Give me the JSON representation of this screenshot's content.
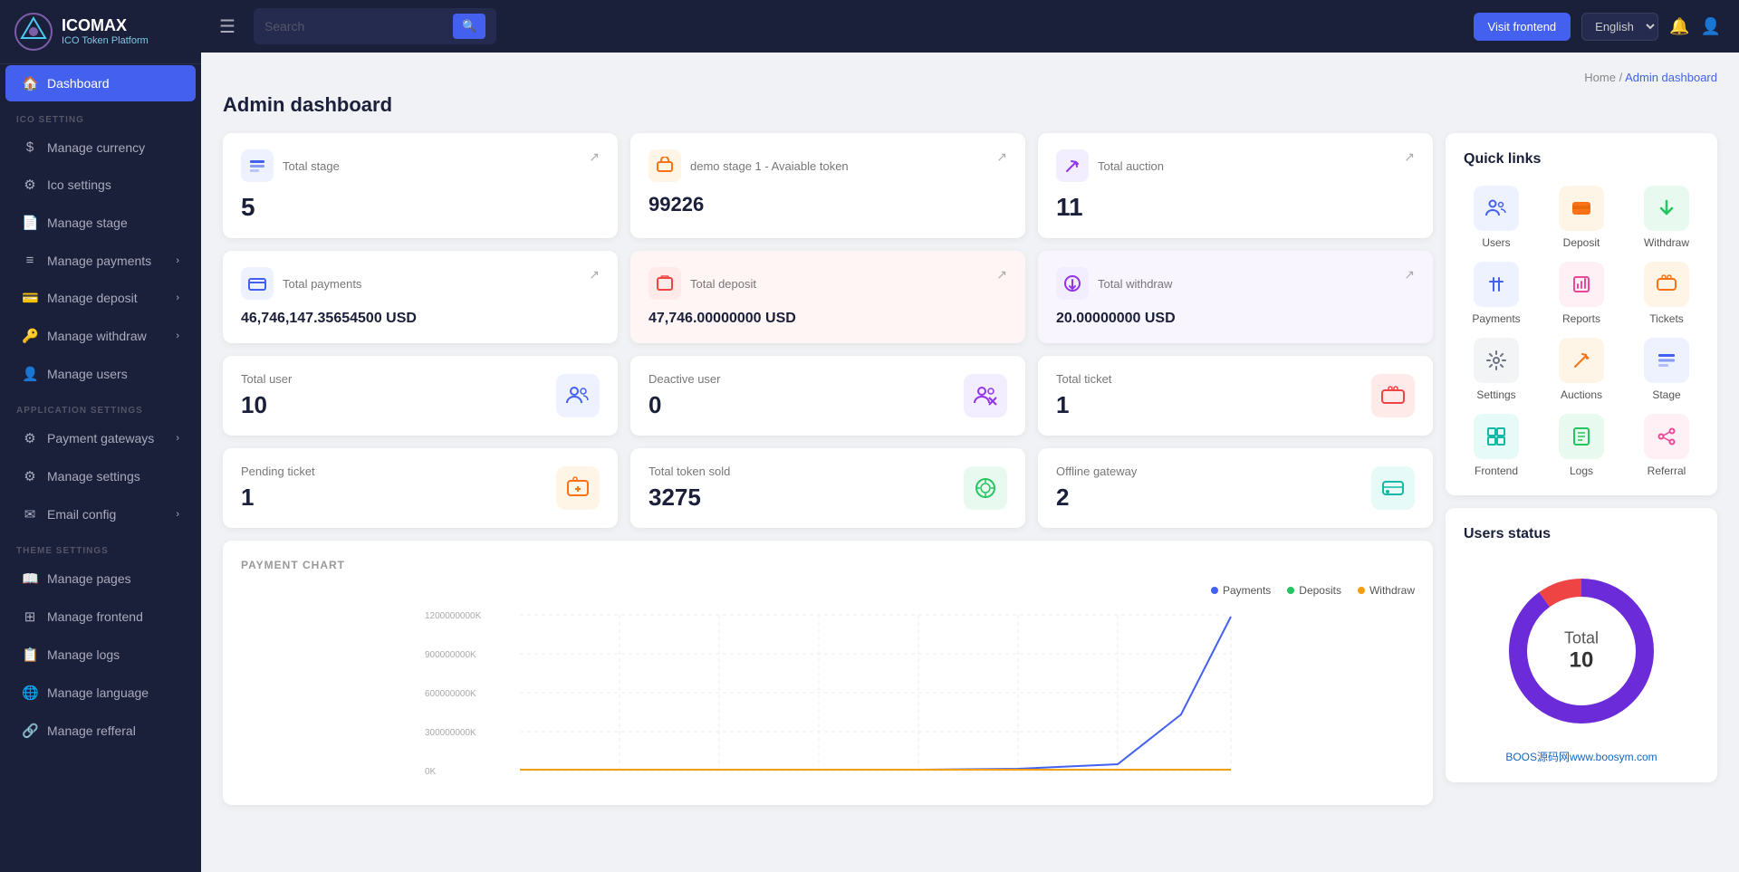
{
  "app": {
    "name": "ICOMAX",
    "sub": "ICO Token Platform"
  },
  "topbar": {
    "search_placeholder": "Search",
    "visit_frontend": "Visit frontend",
    "language": "English"
  },
  "breadcrumb": {
    "home": "Home",
    "current": "Admin dashboard"
  },
  "page": {
    "title": "Admin dashboard"
  },
  "sidebar": {
    "dashboard": "Dashboard",
    "ico_setting_label": "ICO SETTING",
    "manage_currency": "Manage currency",
    "ico_settings": "Ico settings",
    "manage_stage": "Manage stage",
    "manage_payments": "Manage payments",
    "manage_deposit": "Manage deposit",
    "manage_withdraw": "Manage withdraw",
    "manage_users": "Manage users",
    "app_settings_label": "APPLICATION SETTINGS",
    "payment_gateways": "Payment gateways",
    "manage_settings": "Manage settings",
    "email_config": "Email config",
    "theme_settings_label": "THEME SETTINGS",
    "manage_pages": "Manage pages",
    "manage_frontend": "Manage frontend",
    "manage_logs": "Manage logs",
    "manage_language": "Manage language",
    "manage_referral": "Manage refferal"
  },
  "stats": {
    "total_stage_label": "Total stage",
    "total_stage_value": "5",
    "demo_stage_label": "demo stage 1 - Avaiable token",
    "demo_stage_value": "99226",
    "total_auction_label": "Total auction",
    "total_auction_value": "11",
    "total_payments_label": "Total payments",
    "total_payments_value": "46,746,147.35654500 USD",
    "total_deposit_label": "Total deposit",
    "total_deposit_value": "47,746.00000000 USD",
    "total_withdraw_label": "Total withdraw",
    "total_withdraw_value": "20.00000000 USD",
    "total_user_label": "Total user",
    "total_user_value": "10",
    "deactive_user_label": "Deactive user",
    "deactive_user_value": "0",
    "total_ticket_label": "Total ticket",
    "total_ticket_value": "1",
    "pending_ticket_label": "Pending ticket",
    "pending_ticket_value": "1",
    "total_token_sold_label": "Total token sold",
    "total_token_sold_value": "3275",
    "offline_gateway_label": "Offline gateway",
    "offline_gateway_value": "2"
  },
  "quick_links": {
    "title": "Quick links",
    "items": [
      {
        "label": "Users",
        "icon": "👥",
        "bg": "#eef2ff",
        "color": "#4361ee"
      },
      {
        "label": "Deposit",
        "icon": "🟧",
        "bg": "#fff5e6",
        "color": "#f97316"
      },
      {
        "label": "Withdraw",
        "icon": "↑",
        "bg": "#e8faf0",
        "color": "#22c55e"
      },
      {
        "label": "Payments",
        "icon": "⇄",
        "bg": "#eef2ff",
        "color": "#4361ee"
      },
      {
        "label": "Reports",
        "icon": "📊",
        "bg": "#fff0f5",
        "color": "#ec4899"
      },
      {
        "label": "Tickets",
        "icon": "🎫",
        "bg": "#fff5e6",
        "color": "#f97316"
      },
      {
        "label": "Settings",
        "icon": "⚙️",
        "bg": "#f3f4f6",
        "color": "#6b7280"
      },
      {
        "label": "Auctions",
        "icon": "🔥",
        "bg": "#fff5e6",
        "color": "#f97316"
      },
      {
        "label": "Stage",
        "icon": "≡",
        "bg": "#eef2ff",
        "color": "#4361ee"
      },
      {
        "label": "Frontend",
        "icon": "⊞",
        "bg": "#e6faf8",
        "color": "#14b8a6"
      },
      {
        "label": "Logs",
        "icon": "📋",
        "bg": "#e8faf0",
        "color": "#22c55e"
      },
      {
        "label": "Referral",
        "icon": "🔗",
        "bg": "#fff0f5",
        "color": "#ec4899"
      }
    ]
  },
  "chart": {
    "title": "PAYMENT CHART",
    "legend": [
      {
        "label": "Payments",
        "color": "#4361ee"
      },
      {
        "label": "Deposits",
        "color": "#22c55e"
      },
      {
        "label": "Withdraw",
        "color": "#f59e0b"
      }
    ],
    "y_labels": [
      "1200000000K",
      "900000000K",
      "600000000K",
      "300000000K",
      "0K"
    ]
  },
  "users_status": {
    "title": "Users status",
    "total_label": "Total",
    "total_value": "10"
  },
  "watermark": "BOOS源码网www.boosym.com"
}
